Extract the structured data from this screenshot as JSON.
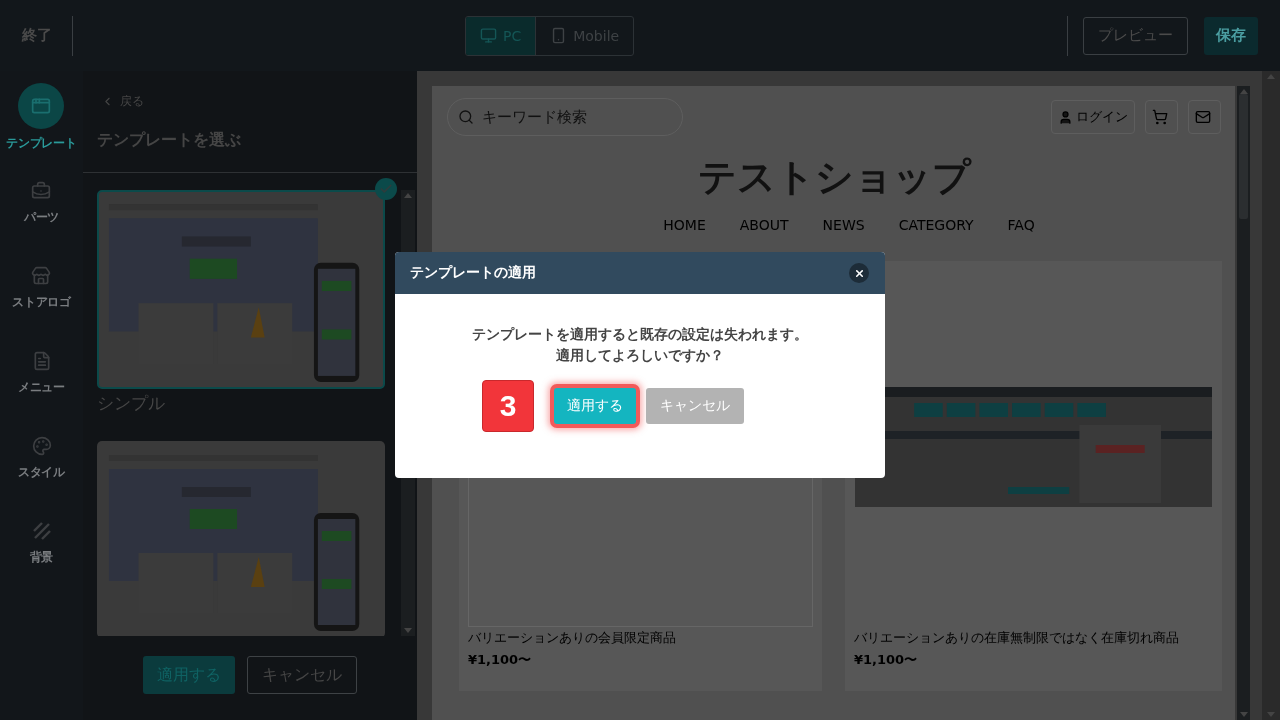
{
  "topbar": {
    "exit": "終了",
    "devices": [
      {
        "label": "PC",
        "kind": "desktop",
        "selected": true
      },
      {
        "label": "Mobile",
        "kind": "mobile",
        "selected": false
      }
    ],
    "preview": "プレビュー",
    "save": "保存"
  },
  "rail": [
    {
      "label": "テンプレート",
      "kind": "template",
      "selected": true
    },
    {
      "label": "パーツ",
      "kind": "parts",
      "selected": false
    },
    {
      "label": "ストアロゴ",
      "kind": "store",
      "selected": false
    },
    {
      "label": "メニュー",
      "kind": "menu",
      "selected": false
    },
    {
      "label": "スタイル",
      "kind": "style",
      "selected": false
    },
    {
      "label": "背景",
      "kind": "background",
      "selected": false
    }
  ],
  "panel": {
    "back": "戻る",
    "title": "テンプレートを選ぶ",
    "templates": [
      {
        "name": "シンプル",
        "selected": true
      },
      {
        "selected": false
      }
    ],
    "apply": "適用する",
    "cancel": "キャンセル"
  },
  "preview": {
    "search_placeholder": "キーワード検索",
    "login": "ログイン",
    "shop_title": "テストショップ",
    "nav": [
      "HOME",
      "ABOUT",
      "NEWS",
      "CATEGORY",
      "FAQ"
    ],
    "products": [
      {
        "kind": "blank",
        "name": "バリエーションありの会員限定商品",
        "price": "¥1,100〜"
      },
      {
        "kind": "picture",
        "name": "バリエーションありの在庫無制限ではなく在庫切れ商品",
        "price": "¥1,100〜"
      }
    ]
  },
  "dialog": {
    "title": "テンプレートの適用",
    "message": [
      "テンプレートを適用すると既存の設定は失われます。",
      "適用してよろしいですか？"
    ],
    "step": "3",
    "apply": "適用する",
    "apply_highlighted": true,
    "cancel": "キャンセル"
  }
}
